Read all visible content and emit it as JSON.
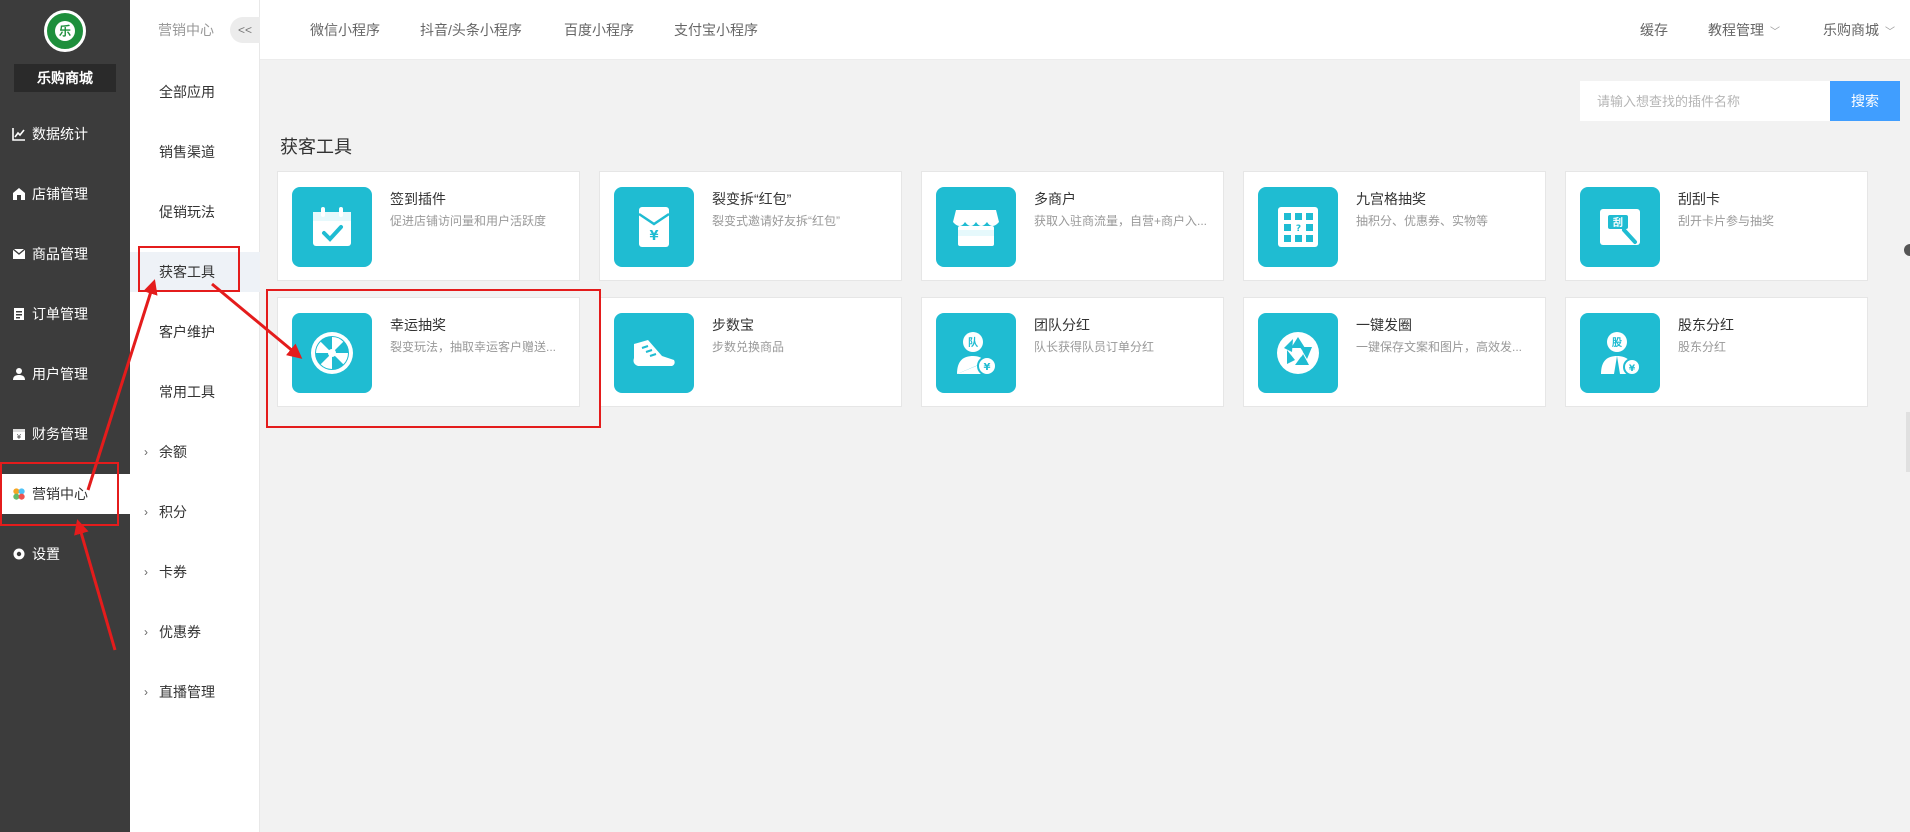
{
  "app": {
    "shop_name": "乐购商城",
    "logo_glyph": "乐"
  },
  "sidebar": {
    "items": [
      {
        "label": "数据统计",
        "icon": "chart-line-icon"
      },
      {
        "label": "店铺管理",
        "icon": "store-icon"
      },
      {
        "label": "商品管理",
        "icon": "box-icon"
      },
      {
        "label": "订单管理",
        "icon": "order-icon"
      },
      {
        "label": "用户管理",
        "icon": "user-icon"
      },
      {
        "label": "财务管理",
        "icon": "finance-icon"
      },
      {
        "label": "营销中心",
        "icon": "marketing-icon",
        "active": true
      },
      {
        "label": "设置",
        "icon": "gear-icon"
      }
    ]
  },
  "subnav": {
    "title": "营销中心",
    "collapse_label": "<<",
    "items": [
      {
        "label": "全部应用"
      },
      {
        "label": "销售渠道"
      },
      {
        "label": "促销玩法"
      },
      {
        "label": "获客工具",
        "active": true
      },
      {
        "label": "客户维护"
      },
      {
        "label": "常用工具"
      },
      {
        "label": "余额",
        "expandable": true
      },
      {
        "label": "积分",
        "expandable": true
      },
      {
        "label": "卡券",
        "expandable": true
      },
      {
        "label": "优惠券",
        "expandable": true
      },
      {
        "label": "直播管理",
        "expandable": true
      }
    ]
  },
  "topbar": {
    "tabs": [
      "微信小程序",
      "抖音/头条小程序",
      "百度小程序",
      "支付宝小程序"
    ],
    "right": {
      "cache": "缓存",
      "tutorial": "教程管理",
      "shop": "乐购商城"
    }
  },
  "search": {
    "placeholder": "请输入想查找的插件名称",
    "button": "搜索"
  },
  "section": {
    "title": "获客工具"
  },
  "plugins": [
    {
      "title": "签到插件",
      "desc": "促进店铺访问量和用户活跃度",
      "icon": "calendar-check-icon"
    },
    {
      "title": "裂变拆“红包”",
      "desc": "裂变式邀请好友拆“红包”",
      "icon": "red-envelope-icon"
    },
    {
      "title": "多商户",
      "desc": "获取入驻商流量，自营+商户入...",
      "icon": "storefront-icon"
    },
    {
      "title": "九宫格抽奖",
      "desc": "抽积分、优惠券、实物等",
      "icon": "grid-lottery-icon"
    },
    {
      "title": "刮刮卡",
      "desc": "刮开卡片参与抽奖",
      "icon": "scratch-card-icon",
      "glyph": "刮"
    },
    {
      "title": "幸运抽奖",
      "desc": "裂变玩法，抽取幸运客户赠送...",
      "icon": "lucky-wheel-icon"
    },
    {
      "title": "步数宝",
      "desc": "步数兑换商品",
      "icon": "sneaker-icon"
    },
    {
      "title": "团队分红",
      "desc": "队长获得队员订单分红",
      "icon": "team-dividend-icon",
      "glyph": "队"
    },
    {
      "title": "一键发圈",
      "desc": "一键保存文案和图片，高效发...",
      "icon": "camera-shutter-icon"
    },
    {
      "title": "股东分红",
      "desc": "股东分红",
      "icon": "shareholder-icon",
      "glyph": "股"
    }
  ],
  "colors": {
    "sidebar_bg": "#3c3c3c",
    "accent": "#409eff",
    "icon_bg": "#1fbcd2",
    "annotation": "#e41c1c"
  }
}
